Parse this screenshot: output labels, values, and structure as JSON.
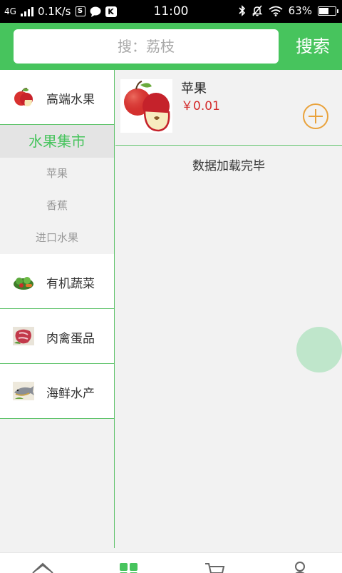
{
  "status_bar": {
    "network": "4G",
    "speed": "0.1K/s",
    "app_icon_s": "S",
    "app_icon_k": "K",
    "time": "11:00",
    "battery": "63%",
    "battery_level": 0.63
  },
  "search": {
    "placeholder": "搜：荔枝",
    "button_label": "搜索"
  },
  "sidebar": {
    "categories_top": [
      {
        "label": "高端水果",
        "icon": "apple-icon"
      }
    ],
    "active_category": "水果集市",
    "subcategories": [
      "苹果",
      "香蕉",
      "进口水果"
    ],
    "categories_bottom": [
      {
        "label": "有机蔬菜",
        "icon": "vegetable-icon"
      },
      {
        "label": "肉禽蛋品",
        "icon": "meat-icon"
      },
      {
        "label": "海鲜水产",
        "icon": "seafood-icon"
      }
    ]
  },
  "products": [
    {
      "name": "苹果",
      "price": "￥0.01",
      "icon": "apple-icon"
    }
  ],
  "list_status": "数据加载完毕",
  "colors": {
    "brand_green": "#47c45d",
    "price_red": "#d32b2b",
    "add_orange": "#e9a23b"
  },
  "tabs": [
    {
      "icon": "home-icon"
    },
    {
      "icon": "category-icon"
    },
    {
      "icon": "cart-icon"
    },
    {
      "icon": "user-icon"
    }
  ]
}
